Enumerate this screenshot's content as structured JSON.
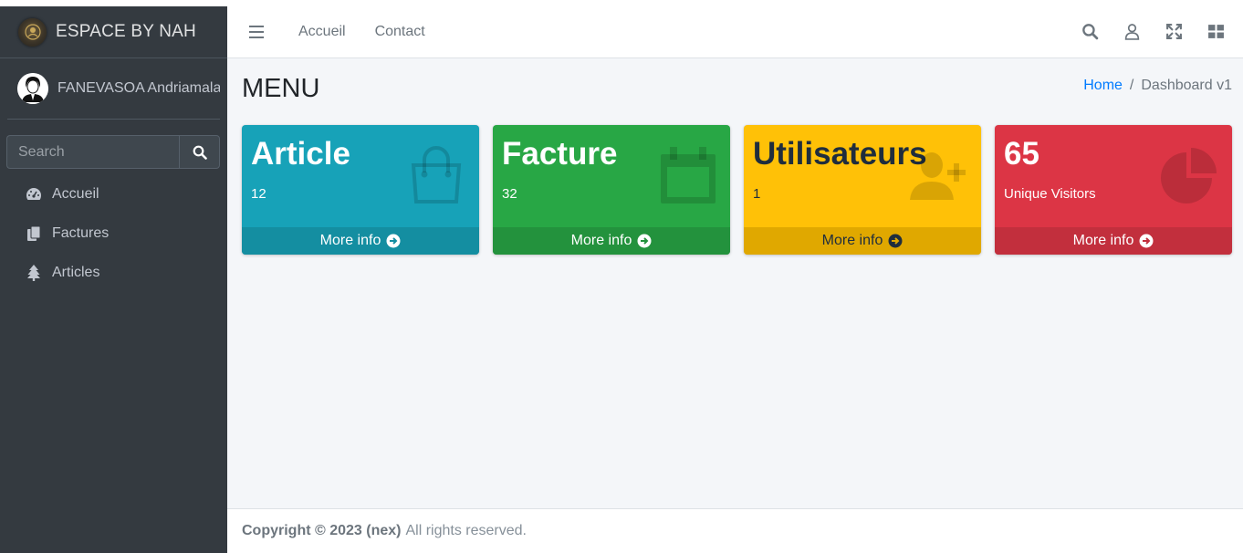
{
  "brand": {
    "text": "ESPACE BY NAH"
  },
  "user": {
    "name": "FANEVASOA Andriamalala"
  },
  "sidebar_search": {
    "placeholder": "Search"
  },
  "nav": [
    {
      "label": "Accueil",
      "icon": "dashboard-gauge-icon"
    },
    {
      "label": "Factures",
      "icon": "copy-files-icon"
    },
    {
      "label": "Articles",
      "icon": "tree-icon"
    }
  ],
  "topbar": {
    "links": [
      "Accueil",
      "Contact"
    ],
    "icons": [
      "search-icon",
      "user-icon",
      "fullscreen-icon",
      "apps-grid-icon"
    ]
  },
  "page": {
    "title": "MENU"
  },
  "breadcrumb": {
    "home": "Home",
    "separator": "/",
    "current": "Dashboard v1"
  },
  "boxes": [
    {
      "title": "Article",
      "value": "12",
      "footer": "More info",
      "color": "#17a2b8",
      "icon": "shopping-bag-icon"
    },
    {
      "title": "Facture",
      "value": "32",
      "footer": "More info",
      "color": "#28a745",
      "icon": "calendar-icon"
    },
    {
      "title": "Utilisateurs",
      "value": "1",
      "footer": "More info",
      "color": "#ffc107",
      "icon": "user-plus-icon"
    },
    {
      "title": "65",
      "value": "Unique Visitors",
      "footer": "More info",
      "color": "#dc3545",
      "icon": "pie-chart-icon"
    }
  ],
  "footer": {
    "copyright": "Copyright © 2023 (nex)",
    "rights": "All rights reserved."
  }
}
